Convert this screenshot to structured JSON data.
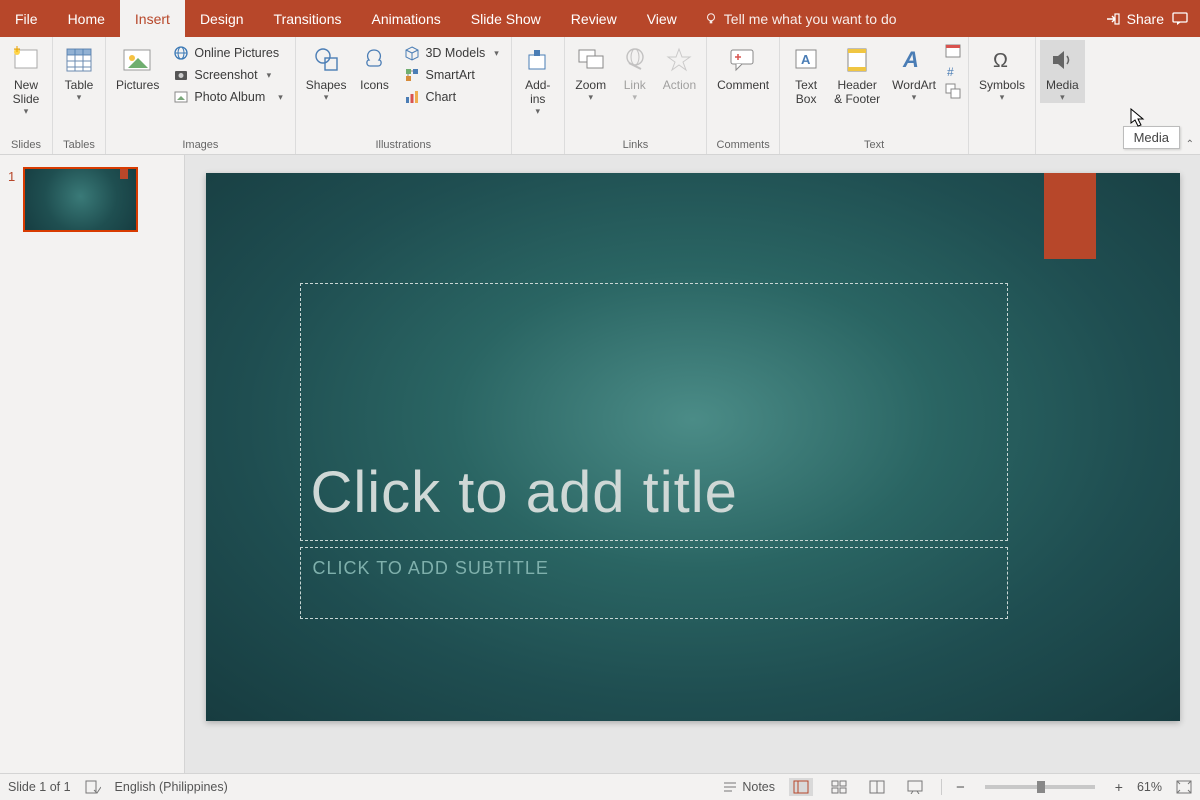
{
  "tabs": {
    "file": "File",
    "home": "Home",
    "insert": "Insert",
    "design": "Design",
    "transitions": "Transitions",
    "animations": "Animations",
    "slideshow": "Slide Show",
    "review": "Review",
    "view": "View",
    "active": "insert"
  },
  "tellme": "Tell me what you want to do",
  "share": "Share",
  "ribbon": {
    "slides": {
      "label": "Slides",
      "new_slide": "New\nSlide"
    },
    "tables": {
      "label": "Tables",
      "table": "Table"
    },
    "images": {
      "label": "Images",
      "pictures": "Pictures",
      "online_pictures": "Online Pictures",
      "screenshot": "Screenshot",
      "photo_album": "Photo Album"
    },
    "illustrations": {
      "label": "Illustrations",
      "shapes": "Shapes",
      "icons": "Icons",
      "models": "3D Models",
      "smartart": "SmartArt",
      "chart": "Chart"
    },
    "addins": {
      "label": "",
      "addins": "Add-\nins"
    },
    "links": {
      "label": "Links",
      "zoom": "Zoom",
      "link": "Link",
      "action": "Action"
    },
    "comments": {
      "label": "Comments",
      "comment": "Comment"
    },
    "text": {
      "label": "Text",
      "textbox": "Text\nBox",
      "header_footer": "Header\n& Footer",
      "wordart": "WordArt"
    },
    "symbols": {
      "label": "",
      "symbols": "Symbols"
    },
    "media": {
      "label": "",
      "media": "Media",
      "tooltip": "Media"
    }
  },
  "thumbs": {
    "1": "1"
  },
  "slide": {
    "title_ph": "Click to add title",
    "subtitle_ph": "CLICK TO ADD SUBTITLE"
  },
  "status": {
    "slide": "Slide 1 of 1",
    "lang": "English (Philippines)",
    "notes": "Notes",
    "zoom": "61%",
    "minus": "−",
    "plus": "+"
  }
}
